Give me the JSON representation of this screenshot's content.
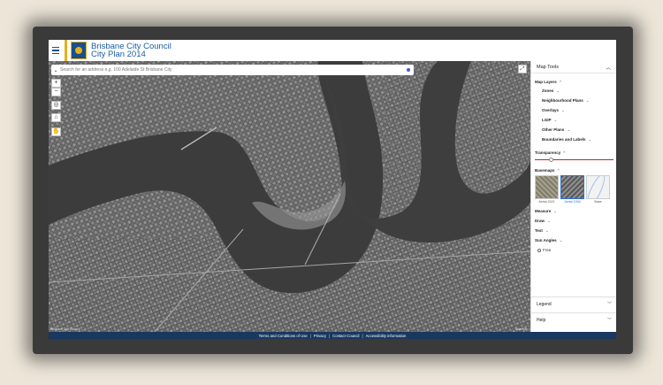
{
  "header": {
    "title_line1": "Brisbane City Council",
    "title_line2": "City Plan 2014"
  },
  "search": {
    "placeholder": "Search for an address e.g. 100 Adelaide St Brisbane City"
  },
  "map": {
    "controls": [
      "+",
      "−",
      "◎",
      "⌂",
      "✋"
    ],
    "attribution_left": "Brisbane City Council",
    "attribution_right": "Nearmap"
  },
  "panel": {
    "title": "Map Tools",
    "map_layers": {
      "label": "Map Layers",
      "items": [
        "Zones",
        "Neighbourhood Plans",
        "Overlays",
        "LGIP",
        "Other Plans",
        "Boundaries and Labels"
      ]
    },
    "transparency": {
      "label": "Transparency",
      "value": 0.2
    },
    "basemaps": {
      "label": "Basemaps",
      "options": [
        {
          "label": "Aerial 2021",
          "selected": false
        },
        {
          "label": "Aerial 1946",
          "selected": true
        },
        {
          "label": "Base",
          "selected": false
        }
      ]
    },
    "tools": [
      "Measure",
      "Draw",
      "Text",
      "Sun Angles"
    ],
    "free_label": "Free",
    "accordions": [
      "Legend",
      "Help"
    ]
  },
  "footer": {
    "links": [
      "Terms and Conditions of Use",
      "Privacy",
      "Contact Council",
      "Accessibility information"
    ]
  },
  "colors": {
    "brand_blue": "#1a5ea8",
    "brand_gold": "#e0b21d",
    "footer_navy": "#19375f",
    "accent_red": "#c0262d"
  }
}
